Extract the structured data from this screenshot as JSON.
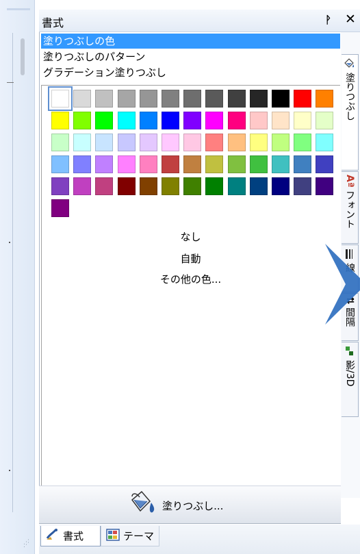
{
  "panel": {
    "title": "書式"
  },
  "fill_menu": {
    "items": [
      "塗りつぶしの色",
      "塗りつぶしのパターン",
      "グラデーション塗りつぶし"
    ],
    "selected_index": 0
  },
  "palette": {
    "rows": [
      [
        "#ffffff",
        "#d9d9d9",
        "#c0c0c0",
        "#a6a6a6",
        "#969696",
        "#808080",
        "#6e6e6e",
        "#5a5a5a",
        "#404040",
        "#262626",
        "#000000",
        "#ff0000",
        "#ff8000"
      ],
      [
        "#ffff00",
        "#80ff00",
        "#00ff00",
        "#00ffff",
        "#0080ff",
        "#0000ff",
        "#8000ff",
        "#ff00ff",
        "#ff0080",
        "#ffc8c8",
        "#ffe4c8",
        "#ffffc8",
        "#e4ffc8"
      ],
      [
        "#c8ffc8",
        "#c8ffff",
        "#c8e4ff",
        "#c8c8ff",
        "#e4c8ff",
        "#ffc8ff",
        "#ffc8e4",
        "#ff8080",
        "#ffc080",
        "#ffff80",
        "#c0ff80",
        "#80ff80",
        "#80ffff"
      ],
      [
        "#80c0ff",
        "#8080ff",
        "#c080ff",
        "#ff80ff",
        "#ff80c0",
        "#c04040",
        "#c08040",
        "#c0c040",
        "#80c040",
        "#40c040",
        "#40c0c0",
        "#4080c0",
        "#4040c0"
      ],
      [
        "#8040c0",
        "#c040c0",
        "#c04080",
        "#800000",
        "#804000",
        "#808000",
        "#408000",
        "#008000",
        "#008080",
        "#004080",
        "#000080",
        "#404080",
        "#400080"
      ],
      [
        "#800080"
      ]
    ],
    "selected_color": "#ffffff"
  },
  "options": {
    "none": "なし",
    "auto": "自動",
    "more": "その他の色..."
  },
  "fill_button": {
    "label": "塗りつぶし..."
  },
  "side_tabs": [
    {
      "label": "塗りつぶし",
      "icon": "paint-bucket-icon"
    },
    {
      "label": "フォント",
      "icon": "font-icon"
    },
    {
      "label": "線",
      "icon": "line-weight-icon"
    },
    {
      "label": "間隔",
      "icon": "spacing-icon"
    },
    {
      "label": "影/3D",
      "icon": "shadow-3d-icon"
    }
  ],
  "bottom_tabs": [
    {
      "label": "書式",
      "icon": "format-brush-icon",
      "active": true
    },
    {
      "label": "テーマ",
      "icon": "theme-palette-icon",
      "active": false
    }
  ],
  "icons": {
    "pin": "pin-icon",
    "close": "close-icon"
  },
  "colors": {
    "selection": "#3399ff",
    "overlay": "#2f6fbf"
  }
}
